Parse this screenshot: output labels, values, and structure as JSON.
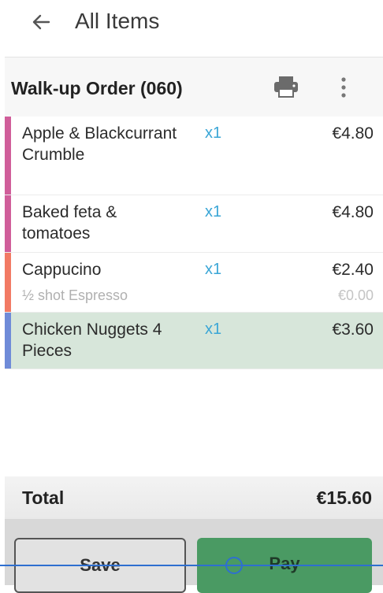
{
  "topbar": {
    "back_icon": "arrow-left-icon",
    "title": "All Items"
  },
  "order": {
    "title": "Walk-up Order (060)",
    "print_icon": "printer-icon",
    "more_icon": "more-vertical-icon",
    "items": [
      {
        "name": "Apple & Blackcurrant Crumble",
        "qty": "x1",
        "price": "€4.80",
        "color": "#d05e9a"
      },
      {
        "name": "Baked feta & tomatoes",
        "qty": "x1",
        "price": "€4.80",
        "color": "#d05e9a"
      },
      {
        "name": "Cappucino",
        "qty": "x1",
        "price": "€2.40",
        "modifier": "½ shot Espresso",
        "modifier_price": "€0.00",
        "color": "#f27a64"
      },
      {
        "name": "Chicken Nuggets 4 Pieces",
        "qty": "x1",
        "price": "€3.60",
        "color": "#6f8bd8",
        "selected": true
      }
    ],
    "total_label": "Total",
    "total_value": "€15.60"
  },
  "actions": {
    "save_label": "Save",
    "pay_label": "Pay"
  },
  "colors": {
    "accent_qty": "#3aa6d6",
    "selected_row": "#d7e6da",
    "pay_button": "#4a9a63"
  }
}
